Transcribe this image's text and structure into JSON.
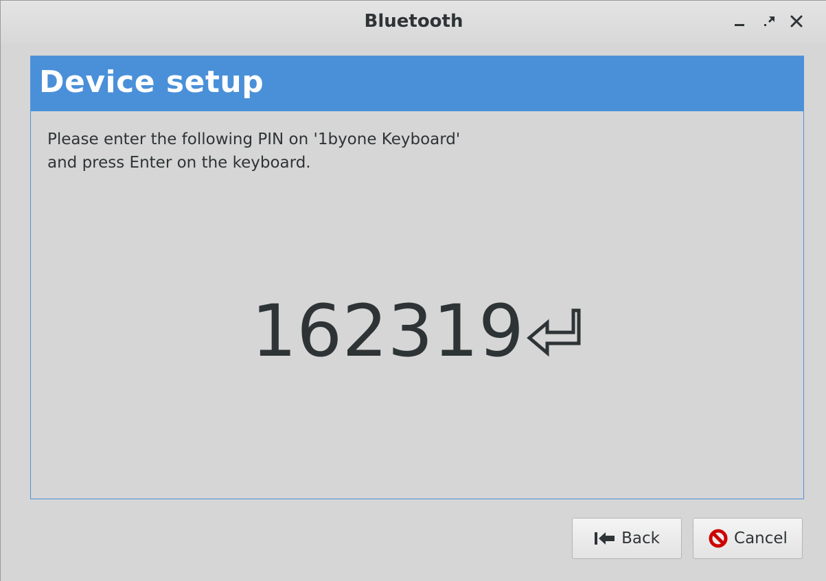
{
  "window": {
    "title": "Bluetooth",
    "controls": [
      "minimize-icon",
      "maximize-icon",
      "close-icon"
    ]
  },
  "panel": {
    "heading": "Device setup",
    "instruction_line1": "Please enter the following PIN on '1byone Keyboard'",
    "instruction_line2": "and press Enter on the keyboard.",
    "pin": "162319",
    "pin_suffix_icon": "enter-key-icon"
  },
  "buttons": {
    "back_label": "Back",
    "back_icon": "back-arrow-icon",
    "cancel_label": "Cancel",
    "cancel_icon": "cancel-icon"
  },
  "colors": {
    "accent": "#4a90d9",
    "text": "#2e3436",
    "background": "#d6d6d6",
    "cancel_icon": "#cc0000"
  }
}
